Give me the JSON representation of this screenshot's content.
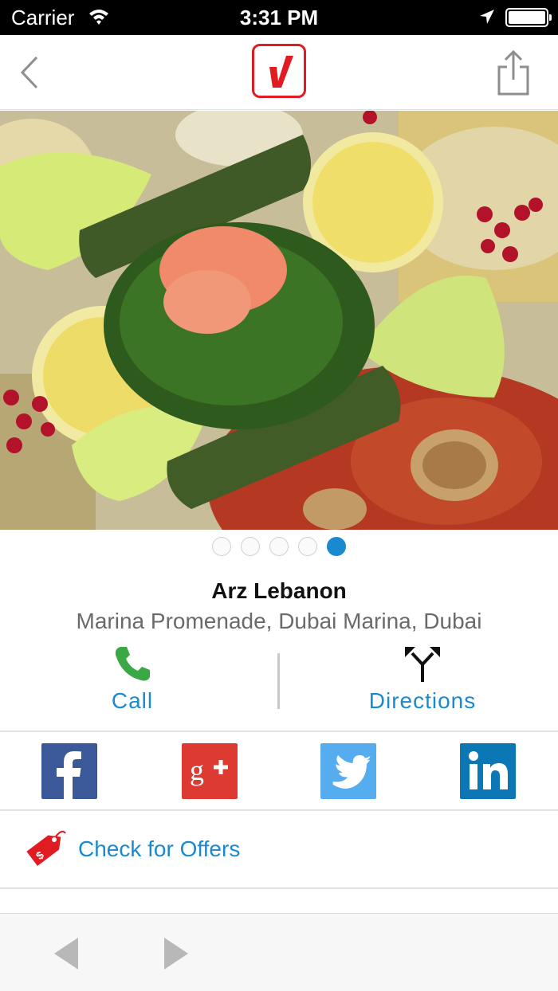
{
  "status_bar": {
    "carrier": "Carrier",
    "time": "3:31 PM",
    "battery_level": 1.0
  },
  "nav": {
    "back_icon": "chevron-left-icon",
    "logo_icon": "checkmark-logo-icon",
    "share_icon": "share-icon",
    "accent_color": "#e11b22"
  },
  "gallery": {
    "image": "mezze-platter-photo",
    "page_count": 5,
    "active_page": 5
  },
  "listing": {
    "name": "Arz Lebanon",
    "address": "Marina Promenade, Dubai Marina, Dubai"
  },
  "actions": {
    "call_label": "Call",
    "directions_label": "Directions",
    "call_icon": "phone-icon",
    "directions_icon": "directions-fork-icon",
    "link_color": "#1a8ad0",
    "call_icon_color": "#3aa845"
  },
  "social": {
    "facebook": {
      "icon": "facebook-icon",
      "color": "#3b5998"
    },
    "google_plus": {
      "icon": "google-plus-icon",
      "color": "#dd3a31"
    },
    "twitter": {
      "icon": "twitter-icon",
      "color": "#55acee"
    },
    "linkedin": {
      "icon": "linkedin-icon",
      "color": "#0b78b5"
    }
  },
  "offers": {
    "label": "Check for Offers",
    "icon": "price-tag-icon"
  },
  "toolbar": {
    "back_icon": "triangle-left-icon",
    "forward_icon": "triangle-right-icon"
  }
}
